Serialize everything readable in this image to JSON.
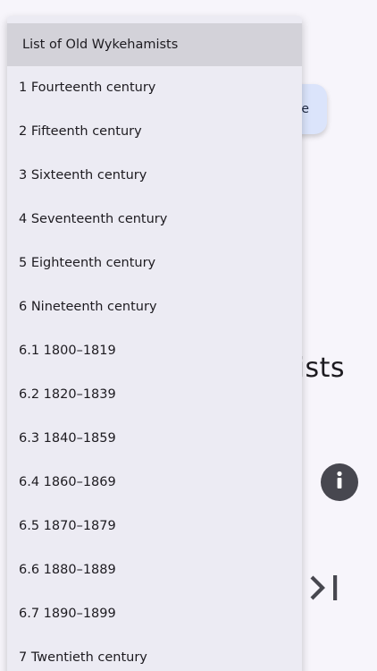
{
  "background": {
    "top_button_label_fragment": "e",
    "title_fragment": "ists",
    "info_icon": "info-icon",
    "last_icon": "skip-to-end-icon"
  },
  "menu": {
    "header": "List of Old Wykehamists",
    "items": [
      "1 Fourteenth century",
      "2 Fifteenth century",
      "3 Sixteenth century",
      "4 Seventeenth century",
      "5 Eighteenth century",
      "6 Nineteenth century",
      "6.1 1800–1819",
      "6.2 1820–1839",
      "6.3 1840–1859",
      "6.4 1860–1869",
      "6.5 1870–1879",
      "6.6 1880–1889",
      "6.7 1890–1899",
      "7 Twentieth century"
    ]
  },
  "colors": {
    "menu_bg": "#ecebf3",
    "header_bg": "#d3d2d9",
    "button_bg": "#dbe4fb",
    "icon_dark": "#47474f"
  }
}
